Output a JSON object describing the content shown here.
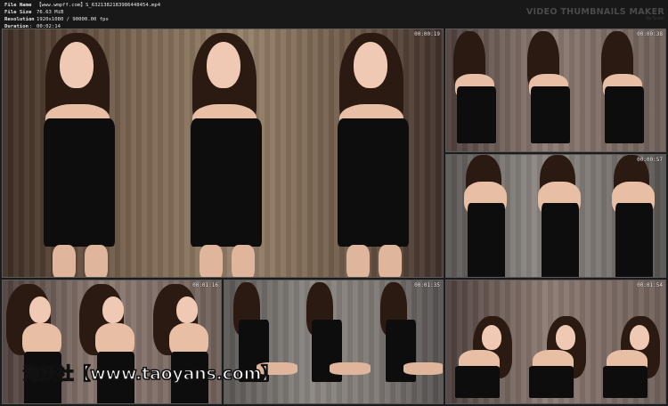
{
  "file_info": {
    "rows": [
      {
        "key": "File Name",
        "value": "【www.wmpff.com】S_6321382183986448454.mp4"
      },
      {
        "key": "File Size",
        "value": "76.63 MiB"
      },
      {
        "key": "Resolution",
        "value": "1920x1080 / 90000.00 fps"
      },
      {
        "key": "Duration",
        "value": "00:02:14"
      }
    ],
    "separator": ":"
  },
  "brand": {
    "title": "VIDEO THUMBNAILS MAKER",
    "subtitle": "by Scion"
  },
  "thumbnails": [
    {
      "timestamp": "00:00:19",
      "scene": "warm"
    },
    {
      "timestamp": "00:00:38",
      "scene": "rose"
    },
    {
      "timestamp": "00:00:57",
      "scene": "cool"
    },
    {
      "timestamp": "00:01:16",
      "scene": "rose"
    },
    {
      "timestamp": "00:01:35",
      "scene": "cool"
    },
    {
      "timestamp": "00:01:54",
      "scene": "rose"
    }
  ],
  "watermark": "淘妖社【www.taoyans.com】",
  "colors": {
    "background": "#1c1c1c",
    "text": "#e8e8e8",
    "brand": "#4a4a4a"
  }
}
